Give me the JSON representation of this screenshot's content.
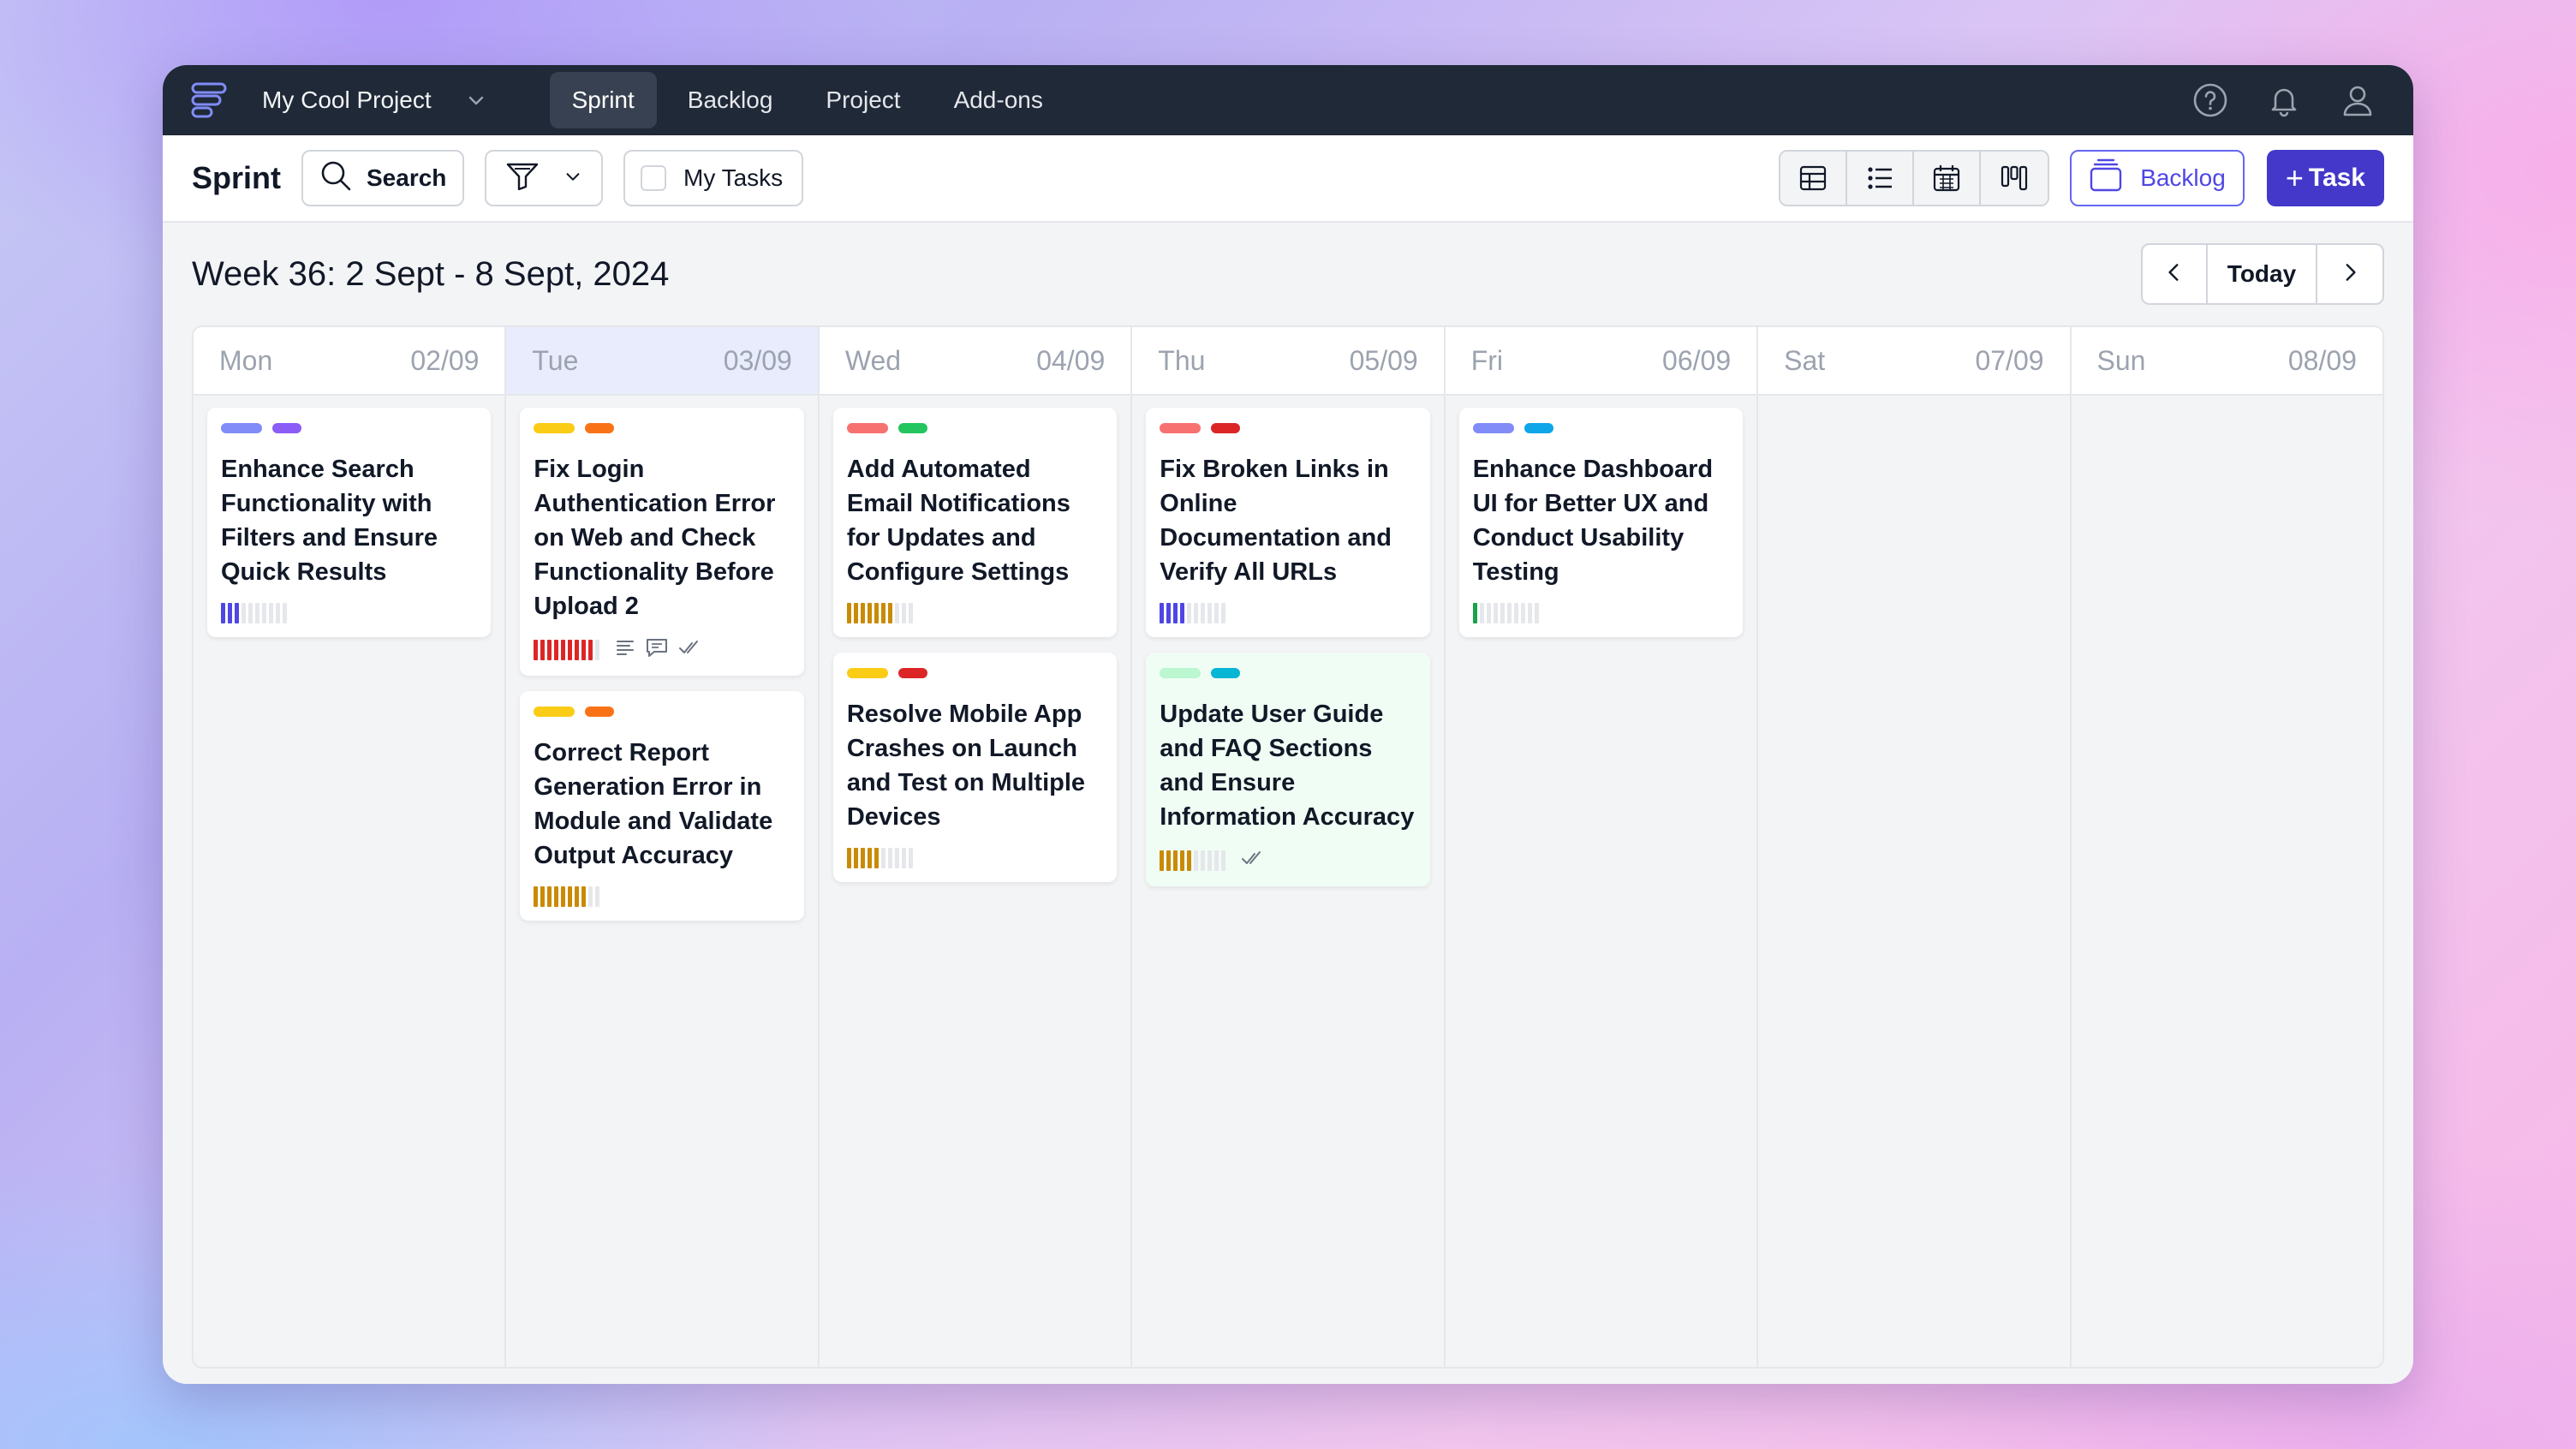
{
  "nav": {
    "project_name": "My Cool Project",
    "tabs": [
      {
        "label": "Sprint",
        "active": true
      },
      {
        "label": "Backlog",
        "active": false
      },
      {
        "label": "Project",
        "active": false
      },
      {
        "label": "Add-ons",
        "active": false
      }
    ]
  },
  "toolbar": {
    "title": "Sprint",
    "search_label": "Search",
    "my_tasks_label": "My Tasks",
    "backlog_label": "Backlog",
    "task_label": "Task",
    "views": [
      "table-view-icon",
      "list-view-icon",
      "calendar-view-icon",
      "board-view-icon"
    ]
  },
  "week": {
    "title": "Week 36: 2 Sept - 8 Sept, 2024",
    "today_label": "Today"
  },
  "colors": {
    "accent": "#4338ca",
    "purple": "#6366f1",
    "violet": "#8b5cf6",
    "yellow": "#facc15",
    "orange": "#f97316",
    "salmon": "#f87171",
    "red": "#dc2626",
    "green": "#22c55e",
    "mint": "#bbf7d0",
    "cyan": "#0ea5e9",
    "teal": "#06b6d4",
    "prog_blue": "#4f46e5",
    "prog_red": "#dc2626",
    "prog_gold": "#ca8a04",
    "prog_green": "#16a34a"
  },
  "days": [
    {
      "name": "Mon",
      "date": "02/09",
      "today": false,
      "cards": [
        {
          "title": "Enhance Search Functionality with Filters and Ensure Quick Results",
          "tags": [
            "#818cf8",
            "#8b5cf6"
          ],
          "progress": 3,
          "progress_color": "#4f46e5",
          "icons": []
        }
      ]
    },
    {
      "name": "Tue",
      "date": "03/09",
      "today": true,
      "cards": [
        {
          "title": "Fix Login Authentication Error on Web and Check Functionality Before Upload 2",
          "tags": [
            "#facc15",
            "#f97316"
          ],
          "progress": 9,
          "progress_color": "#dc2626",
          "icons": [
            "description-icon",
            "comment-icon",
            "check-icon"
          ]
        },
        {
          "title": "Correct Report Generation Error in Module and Validate Output Accuracy",
          "tags": [
            "#facc15",
            "#f97316"
          ],
          "progress": 8,
          "progress_color": "#ca8a04",
          "icons": []
        }
      ]
    },
    {
      "name": "Wed",
      "date": "04/09",
      "today": false,
      "cards": [
        {
          "title": "Add Automated Email Notifications for Updates and Configure Settings",
          "tags": [
            "#f87171",
            "#22c55e"
          ],
          "progress": 7,
          "progress_color": "#ca8a04",
          "icons": []
        },
        {
          "title": "Resolve Mobile App Crashes on Launch and Test on Multiple Devices",
          "tags": [
            "#facc15",
            "#dc2626"
          ],
          "progress": 5,
          "progress_color": "#ca8a04",
          "icons": []
        }
      ]
    },
    {
      "name": "Thu",
      "date": "05/09",
      "today": false,
      "cards": [
        {
          "title": "Fix Broken Links in Online Documentation and Verify All URLs",
          "tags": [
            "#f87171",
            "#dc2626"
          ],
          "progress": 4,
          "progress_color": "#4f46e5",
          "icons": []
        },
        {
          "title": "Update User Guide and FAQ Sections and Ensure Information Accuracy",
          "tags": [
            "#bbf7d0",
            "#06b6d4"
          ],
          "progress": 5,
          "progress_color": "#ca8a04",
          "icons": [
            "check-icon"
          ],
          "green": true
        }
      ]
    },
    {
      "name": "Fri",
      "date": "06/09",
      "today": false,
      "cards": [
        {
          "title": "Enhance Dashboard UI for Better UX and Conduct Usability Testing",
          "tags": [
            "#818cf8",
            "#0ea5e9"
          ],
          "progress": 1,
          "progress_color": "#16a34a",
          "icons": []
        }
      ]
    },
    {
      "name": "Sat",
      "date": "07/09",
      "today": false,
      "cards": []
    },
    {
      "name": "Sun",
      "date": "08/09",
      "today": false,
      "cards": []
    }
  ]
}
